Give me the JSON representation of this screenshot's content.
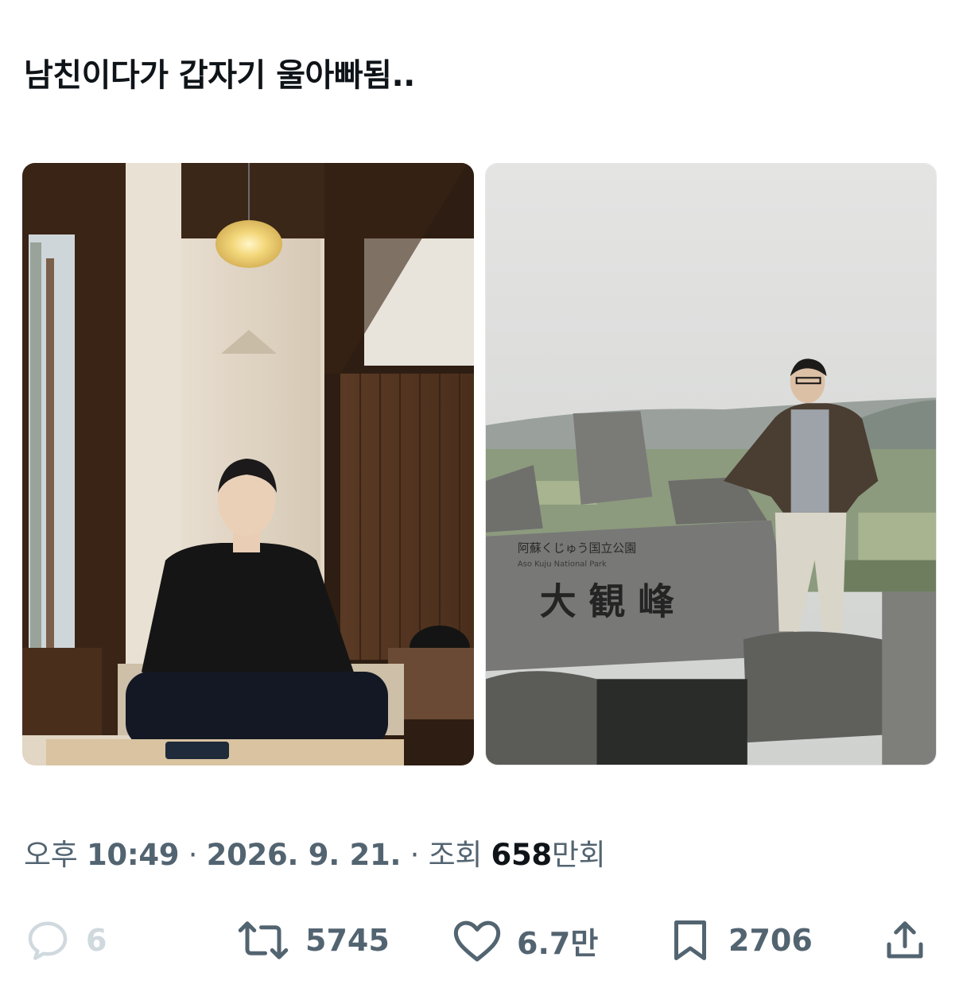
{
  "tweet": {
    "text": "남친이다가 갑자기 울아빠됨.."
  },
  "media": [
    {
      "alt_icon": "photo-cafe-interior",
      "sign_text": ""
    },
    {
      "alt_icon": "photo-mountain-monument",
      "sign_line1": "阿蘇くじゅう国立公園",
      "sign_line2": "Aso Kuju National Park",
      "sign_main": "大 観 峰"
    }
  ],
  "meta": {
    "time_prefix": "오후",
    "time": "10:49",
    "dot1": "·",
    "date": "2026. 9. 21.",
    "dot2": "·",
    "views_label": "조회",
    "views_count": "658",
    "views_unit": "만회"
  },
  "actions": {
    "replies": "6",
    "reposts": "5745",
    "likes": "6.7만",
    "bookmarks": "2706"
  },
  "colors": {
    "text": "#0f1419",
    "secondary": "#536471",
    "reply_muted": "#cfd9de"
  }
}
